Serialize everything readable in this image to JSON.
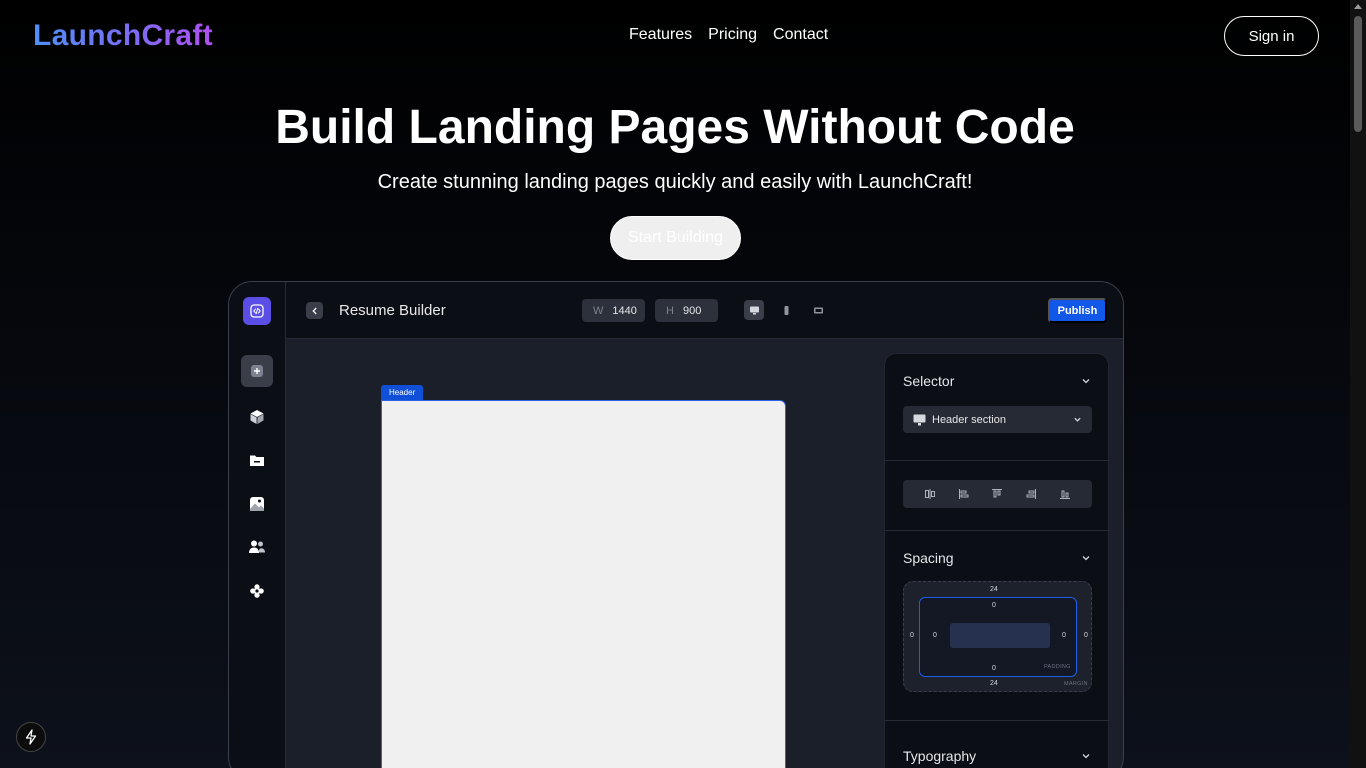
{
  "nav": {
    "brand": "LaunchCraft",
    "links": [
      "Features",
      "Pricing",
      "Contact"
    ],
    "signin_label": "Sign in"
  },
  "hero": {
    "title": "Build Landing Pages Without Code",
    "subtitle": "Create stunning landing pages quickly and easily with LaunchCraft!",
    "cta_label": "Start Building"
  },
  "editor": {
    "doc_title": "Resume Builder",
    "width_label": "W",
    "width_value": "1440",
    "height_label": "H",
    "height_value": "900",
    "publish_label": "Publish",
    "canvas_tag": "Header",
    "sidebar_icons": [
      "add-icon",
      "cube-icon",
      "folder-icon",
      "image-icon",
      "users-icon",
      "settings-icon"
    ],
    "device_icons": [
      "desktop-icon",
      "mobile-icon",
      "tablet-icon"
    ],
    "panel": {
      "selector_title": "Selector",
      "selector_value": "Header section",
      "spacing_title": "Spacing",
      "typography_title": "Typography",
      "margin_top": "24",
      "margin_bottom": "24",
      "margin_left": "0",
      "margin_right": "0",
      "padding_top": "0",
      "padding_bottom": "0",
      "padding_left": "0",
      "padding_right": "0",
      "padding_label": "PADDING",
      "margin_label": "MARGIN"
    }
  },
  "colors": {
    "accent": "#1158e8",
    "brand_gradient": [
      "#4f8ff7",
      "#7b6cf3",
      "#b04ff0"
    ],
    "editor_bg": "#1b1f29",
    "panel_bg": "#0b0e14"
  }
}
